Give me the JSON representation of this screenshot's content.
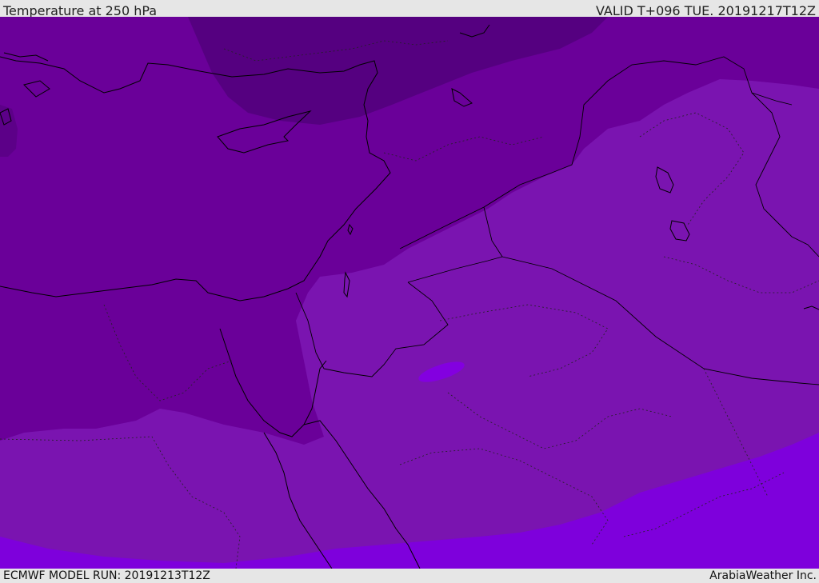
{
  "header": {
    "title": "Temperature at 250 hPa",
    "valid": "VALID T+096 TUE. 20191217T12Z"
  },
  "footer": {
    "model_run": "ECMWF MODEL RUN: 20191213T12Z",
    "credit": "ArabiaWeather Inc."
  },
  "map": {
    "colors": {
      "band_darkest": "#550080",
      "band_dark": "#6a0099",
      "band_mid": "#7a14b0",
      "band_light": "#7e00dc",
      "coastline": "#000000",
      "border": "#000000"
    }
  }
}
